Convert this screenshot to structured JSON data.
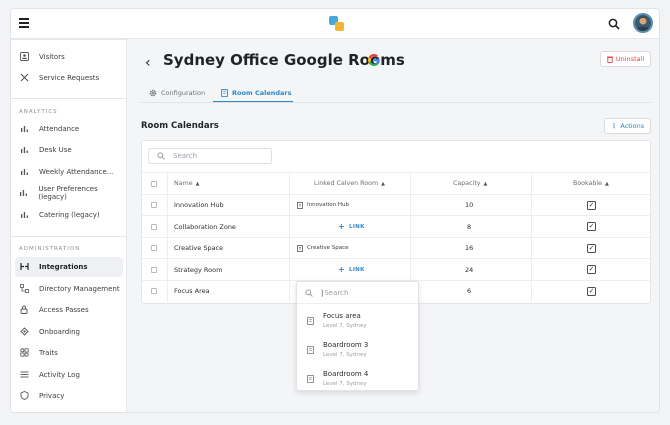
{
  "sidebar": {
    "items_top": [
      {
        "label": "Visitors",
        "icon": "visitor-badge-icon"
      },
      {
        "label": "Service Requests",
        "icon": "tools-icon"
      }
    ],
    "analytics_label": "ANALYTICS",
    "analytics": [
      {
        "label": "Attendance"
      },
      {
        "label": "Desk Use"
      },
      {
        "label": "Weekly Attendance..."
      },
      {
        "label": "User Preferences (legacy)"
      },
      {
        "label": "Catering (legacy)"
      }
    ],
    "admin_label": "ADMINISTRATION",
    "admin": [
      {
        "label": "Integrations",
        "icon": "integrations-icon",
        "active": true
      },
      {
        "label": "Directory Management",
        "icon": "directory-icon"
      },
      {
        "label": "Access Passes",
        "icon": "lock-icon"
      },
      {
        "label": "Onboarding",
        "icon": "onboarding-icon"
      },
      {
        "label": "Traits",
        "icon": "traits-icon"
      },
      {
        "label": "Activity Log",
        "icon": "list-icon"
      },
      {
        "label": "Privacy",
        "icon": "shield-icon"
      }
    ]
  },
  "header": {
    "title": "Sydney Office Google Rooms",
    "uninstall_label": "Uninstall"
  },
  "tabs": [
    {
      "label": "Configuration",
      "active": false
    },
    {
      "label": "Room Calendars",
      "active": true
    }
  ],
  "section": {
    "title": "Room Calendars",
    "actions_label": "Actions",
    "search_placeholder": "Search"
  },
  "table": {
    "columns": [
      "Name",
      "Linked Calven Room",
      "Capacity",
      "Bookable"
    ],
    "rows": [
      {
        "name": "Innovation Hub",
        "linked": "Innovation Hub",
        "capacity": "10",
        "bookable": true
      },
      {
        "name": "Collaboration Zone",
        "linked": "",
        "link_label": "LINK",
        "capacity": "8",
        "bookable": true
      },
      {
        "name": "Creative Space",
        "linked": "Creative Space",
        "capacity": "16",
        "bookable": true
      },
      {
        "name": "Strategy Room",
        "linked": "",
        "link_label": "LINK",
        "capacity": "24",
        "bookable": true
      },
      {
        "name": "Focus Area",
        "linked": "",
        "capacity": "6",
        "bookable": true
      }
    ]
  },
  "dropdown": {
    "search_placeholder": "Search",
    "options": [
      {
        "name": "Focus area",
        "location": "Level 7, Sydney"
      },
      {
        "name": "Boardroom 3",
        "location": "Level 7, Sydney"
      },
      {
        "name": "Boardroom 4",
        "location": "Level 7, Sydney"
      }
    ]
  },
  "colors": {
    "accent": "#2f86c9",
    "danger": "#e0474c"
  }
}
